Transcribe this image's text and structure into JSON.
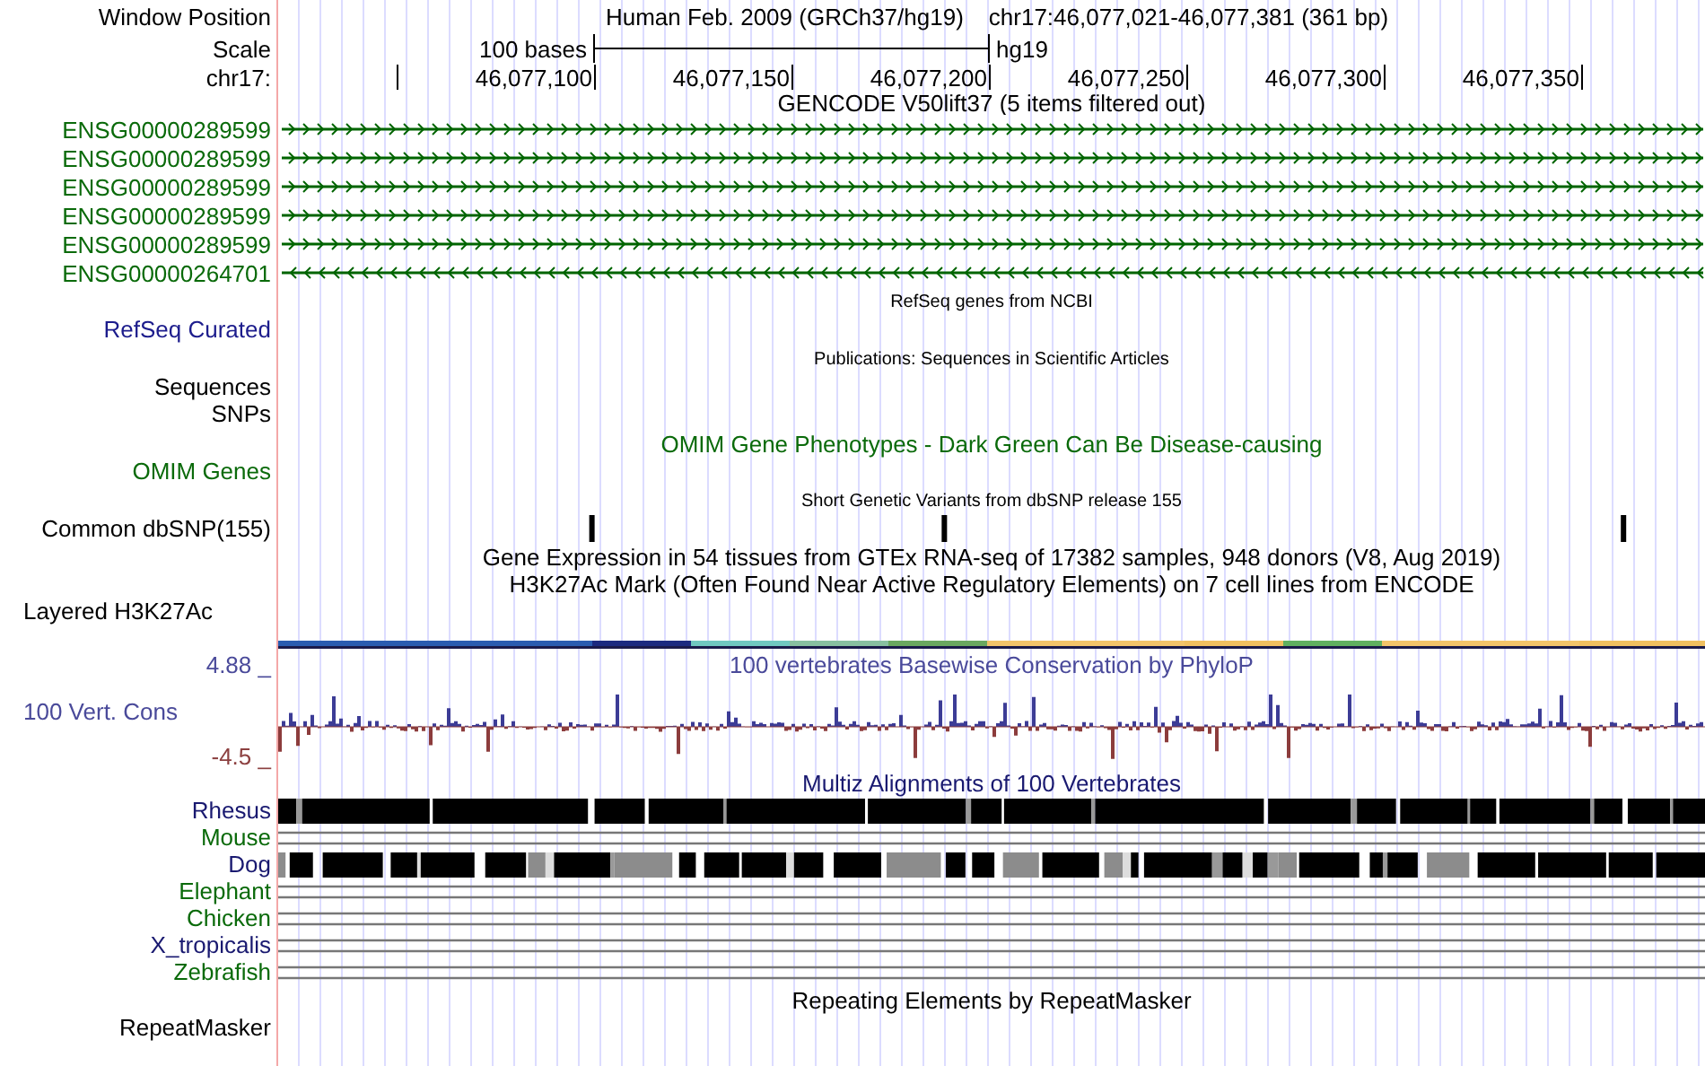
{
  "position": {
    "label": "Window Position",
    "assembly": "Human Feb. 2009 (GRCh37/hg19)",
    "range": "chr17:46,077,021-46,077,381 (361 bp)"
  },
  "scale": {
    "label": "Scale",
    "span": "100 bases",
    "assembly": "hg19"
  },
  "ruler": {
    "label": "chr17:",
    "ticks": [
      "46,077,100",
      "46,077,150",
      "46,077,200",
      "46,077,250",
      "46,077,300",
      "46,077,350"
    ]
  },
  "gencode": {
    "title": "GENCODE V50lift37 (5 items filtered out)",
    "genes": [
      {
        "name": "ENSG00000289599",
        "kind": "forward"
      },
      {
        "name": "ENSG00000289599",
        "kind": "forward"
      },
      {
        "name": "ENSG00000289599",
        "kind": "forward"
      },
      {
        "name": "ENSG00000289599",
        "kind": "forward"
      },
      {
        "name": "ENSG00000289599",
        "kind": "forward"
      },
      {
        "name": "ENSG00000264701",
        "kind": "reverse"
      }
    ]
  },
  "tracks": [
    {
      "kind": "feature",
      "title": {
        "text": "RefSeq genes from NCBI",
        "kind": "small"
      },
      "labels": [
        {
          "text": "RefSeq Curated",
          "color": "#1c1c8c"
        }
      ]
    },
    {
      "kind": "feature",
      "title": {
        "text": "Publications: Sequences in Scientific Articles",
        "kind": "small"
      },
      "labels": [
        {
          "text": "Sequences",
          "color": "#000000"
        },
        {
          "text": "SNPs",
          "color": "#000000"
        }
      ]
    },
    {
      "kind": "feature",
      "title": {
        "text": "OMIM Gene Phenotypes - Dark Green Can Be Disease-causing",
        "kind": "large",
        "color": "#0a6a0a"
      },
      "labels": [
        {
          "text": "OMIM Genes",
          "color": "#0a6a0a"
        }
      ]
    },
    {
      "kind": "variants",
      "title": {
        "text": "Short Genetic Variants from dbSNP release 155",
        "kind": "small"
      },
      "labels": [
        {
          "text": "Common dbSNP(155)",
          "color": "#000000"
        }
      ]
    },
    {
      "kind": "signal",
      "titles": [
        "Gene Expression in 54 tissues from GTEx RNA-seq of 17382 samples, 948 donors (V8, Aug 2019)",
        "H3K27Ac Mark (Often Found Near Active Regulatory Elements) on 7 cell lines from ENCODE"
      ],
      "labels": [
        {
          "text": "Layered H3K27Ac",
          "color": "#000000"
        }
      ]
    },
    {
      "kind": "conservation",
      "title": {
        "text": "100 vertebrates Basewise Conservation by PhyloP",
        "color": "#4a4a9a"
      },
      "label": {
        "text": "100 Vert. Cons",
        "color": "#4a4a9a"
      },
      "max": "4.88 _",
      "min": "-4.5 _"
    },
    {
      "kind": "alignment",
      "title": {
        "text": "Multiz Alignments of 100 Vertebrates",
        "color": "#191970"
      },
      "species": [
        {
          "name": "Rhesus",
          "color": "#191970",
          "kind": "blocks"
        },
        {
          "name": "Mouse",
          "color": "#0a6a0a",
          "kind": "lines"
        },
        {
          "name": "Dog",
          "color": "#191970",
          "kind": "blocks"
        },
        {
          "name": "Elephant",
          "color": "#0a6a0a",
          "kind": "lines"
        },
        {
          "name": "Chicken",
          "color": "#0a6a0a",
          "kind": "lines"
        },
        {
          "name": "X_tropicalis",
          "color": "#191970",
          "kind": "lines"
        },
        {
          "name": "Zebrafish",
          "color": "#0a6a0a",
          "kind": "lines"
        }
      ]
    },
    {
      "kind": "feature",
      "title": {
        "text": "Repeating Elements by RepeatMasker",
        "kind": "large"
      },
      "labels": [
        {
          "text": "RepeatMasker",
          "color": "#000000"
        }
      ]
    }
  ]
}
